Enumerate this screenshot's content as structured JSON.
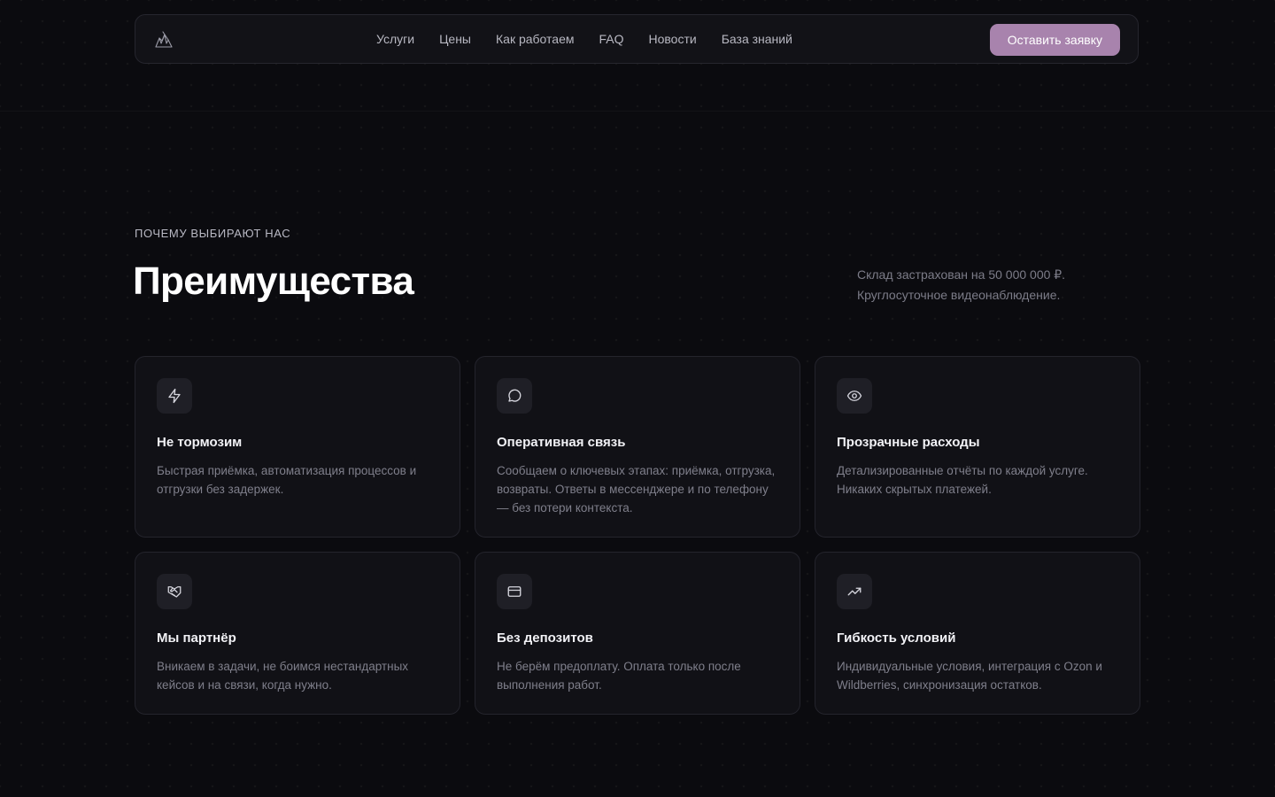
{
  "nav": {
    "logo_alt": "logo",
    "links": [
      "Услуги",
      "Цены",
      "Как работаем",
      "FAQ",
      "Новости",
      "База знаний"
    ],
    "cta_label": "Оставить заявку"
  },
  "colors": {
    "background": "#0b0b0f",
    "card_bg": "#111116",
    "accent": "#a883ad",
    "text_muted": "#7f7f8b"
  },
  "section": {
    "eyebrow": "ПОЧЕМУ ВЫБИРАЮТ НАС",
    "title": "Преимущества",
    "note_line1": "Склад застрахован на 50 000 000 ₽.",
    "note_line2": "Круглосуточное видеонаблюдение."
  },
  "cards": [
    {
      "icon": "lightning-icon",
      "title": "Не тормозим",
      "text": "Быстрая приёмка, автоматизация процессов и отгрузки без задержек."
    },
    {
      "icon": "message-icon",
      "title": "Оперативная связь",
      "text": "Сообщаем о ключевых этапах: приёмка, отгрузка, возвраты. Ответы в мессенджере и по телефону — без потери контекста."
    },
    {
      "icon": "eye-icon",
      "title": "Прозрачные расходы",
      "text": "Детализированные отчёты по каждой услуге. Никаких скрытых платежей."
    },
    {
      "icon": "handshake-icon",
      "title": "Мы партнёр",
      "text": "Вникаем в задачи, не боимся нестандартных кейсов и на связи, когда нужно."
    },
    {
      "icon": "credit-card-icon",
      "title": "Без депозитов",
      "text": "Не берём предоплату. Оплата только после выполнения работ."
    },
    {
      "icon": "trending-up-icon",
      "title": "Гибкость условий",
      "text": "Индивидуальные условия, интеграция с Ozon и Wildberries, синхронизация остатков."
    }
  ]
}
